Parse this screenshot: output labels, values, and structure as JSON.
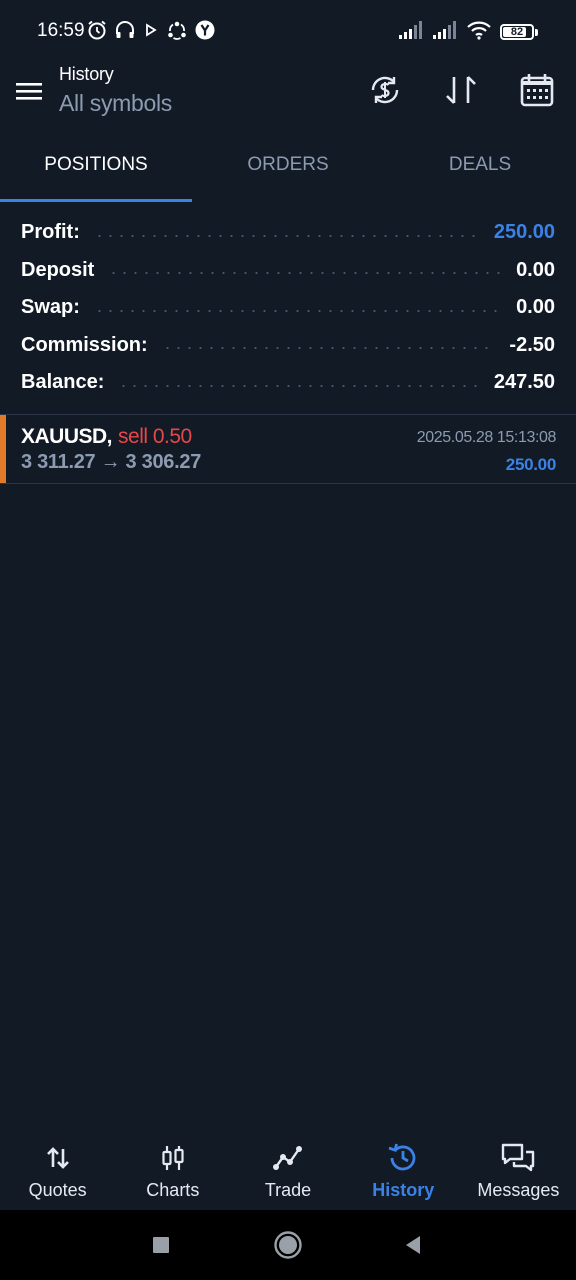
{
  "status_bar": {
    "time": "16:59",
    "battery": "82",
    "battery_level": 0.82,
    "left_icons": [
      "alarm-icon",
      "headphones-icon",
      "play-icon",
      "sync-icon",
      "yandex-icon"
    ],
    "right_icons": [
      "signal-icon",
      "signal-icon",
      "wifi-icon",
      "battery-icon"
    ]
  },
  "app_bar": {
    "title": "History",
    "subtitle": "All symbols",
    "actions": [
      "currency-refresh-icon",
      "sort-icon",
      "calendar-icon"
    ]
  },
  "tabs": [
    {
      "label": "POSITIONS",
      "active": true
    },
    {
      "label": "ORDERS",
      "active": false
    },
    {
      "label": "DEALS",
      "active": false
    }
  ],
  "summary": [
    {
      "label": "Profit:",
      "value": "250.00"
    },
    {
      "label": "Deposit",
      "value": "0.00"
    },
    {
      "label": "Swap:",
      "value": "0.00"
    },
    {
      "label": "Commission:",
      "value": "-2.50"
    },
    {
      "label": "Balance:",
      "value": "247.50"
    }
  ],
  "position": {
    "symbol": "XAUUSD,",
    "type": "sell 0.50",
    "prices": "3 311.27 → 3 306.27",
    "time": "2025.05.28 15:13:08",
    "profit": "250.00"
  },
  "bottom_nav": [
    {
      "label": "Quotes",
      "icon": "quotes-icon",
      "active": false
    },
    {
      "label": "Charts",
      "icon": "charts-icon",
      "active": false
    },
    {
      "label": "Trade",
      "icon": "trade-icon",
      "active": false
    },
    {
      "label": "History",
      "icon": "history-icon",
      "active": true
    },
    {
      "label": "Messages",
      "icon": "messages-icon",
      "active": false
    }
  ],
  "colors": {
    "background": "#121a26",
    "accent": "#3b82e6",
    "sell": "#e8474a",
    "position_marker": "#e07a2a",
    "muted_text": "#8c9bb0"
  }
}
